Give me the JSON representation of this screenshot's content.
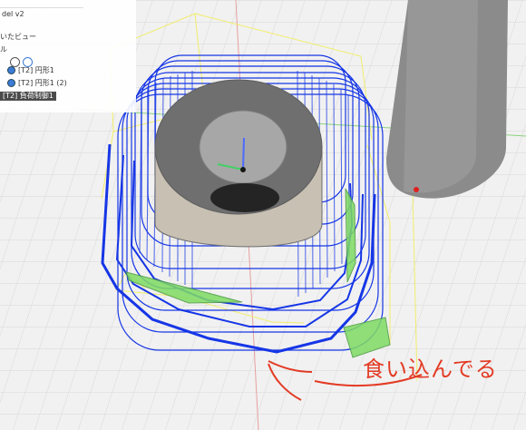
{
  "browser": {
    "doc_title": "del v2",
    "named_views_label": "いたビュー",
    "item_label": "ル",
    "sketch_items": [
      "[T2] 円形1",
      "[T2] 円形1 (2)"
    ],
    "selected_item": "[T2] 負荷制御1"
  },
  "annotation": {
    "text": "食い込んでる",
    "color": "#e33b25"
  },
  "colors": {
    "toolpath": "#1636e6",
    "stock": "#c7c0b3",
    "tool": "#9a9a9a",
    "boundary": "#f1ed6a"
  }
}
